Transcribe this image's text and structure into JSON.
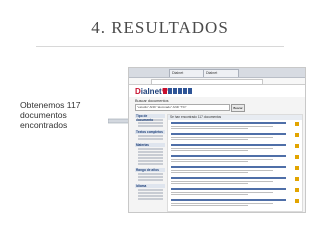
{
  "slide": {
    "title": "4. RESULTADOS",
    "caption_lines": [
      "Obtenemos 117",
      "documentos",
      "encontrados"
    ]
  },
  "colors": {
    "title_text": "#4a4a4a",
    "caption_text": "#333333",
    "dialnet_blue": "#1d3f79",
    "dialnet_red": "#c8102e"
  },
  "screenshot": {
    "tabs": [
      "Dialnet",
      "Dialnet"
    ],
    "logo_prefix": "D",
    "logo_rest": "ialnet",
    "logo_suffix": "plus",
    "search_label": "Buscar documentos",
    "search_value": "\"estudio\" AND \"alumnado\" AND \"TIC\"",
    "search_button": "Buscar",
    "results_header": "Se han encontrado 117 documentos",
    "sidebar_sections": [
      "Tipo de documento",
      "Textos completos",
      "Materias",
      "Rango de años",
      "Idioma"
    ]
  }
}
